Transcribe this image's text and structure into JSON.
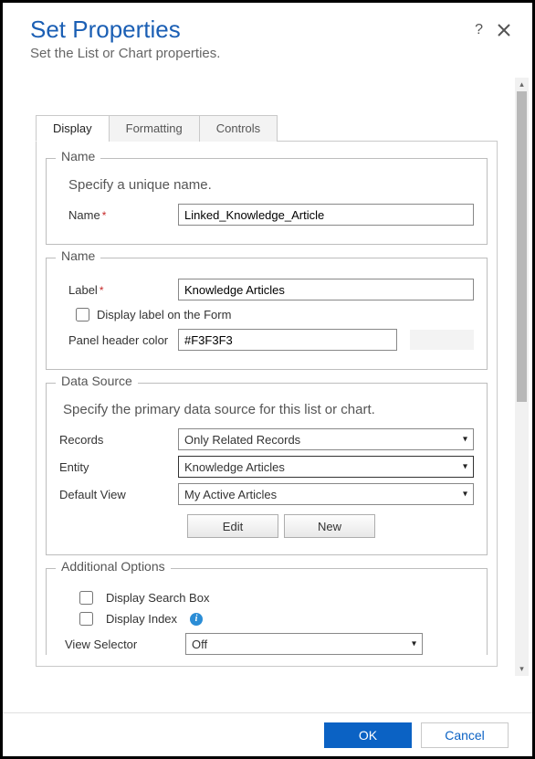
{
  "header": {
    "title": "Set Properties",
    "subtitle": "Set the List or Chart properties."
  },
  "tabs": [
    "Display",
    "Formatting",
    "Controls"
  ],
  "sections": {
    "name1": {
      "legend": "Name",
      "instruction": "Specify a unique name.",
      "name_label": "Name",
      "name_value": "Linked_Knowledge_Article"
    },
    "name2": {
      "legend": "Name",
      "label_label": "Label",
      "label_value": "Knowledge Articles",
      "display_label_checkbox": "Display label on the Form",
      "panel_color_label": "Panel header color",
      "panel_color_value": "#F3F3F3"
    },
    "dataSource": {
      "legend": "Data Source",
      "instruction": "Specify the primary data source for this list or chart.",
      "records_label": "Records",
      "records_value": "Only Related Records",
      "entity_label": "Entity",
      "entity_value": "Knowledge Articles",
      "default_view_label": "Default View",
      "default_view_value": "My Active Articles",
      "edit_btn": "Edit",
      "new_btn": "New"
    },
    "additional": {
      "legend": "Additional Options",
      "display_search": "Display Search Box",
      "display_index": "Display Index",
      "view_selector_label": "View Selector",
      "view_selector_value": "Off"
    }
  },
  "footer": {
    "ok": "OK",
    "cancel": "Cancel"
  }
}
